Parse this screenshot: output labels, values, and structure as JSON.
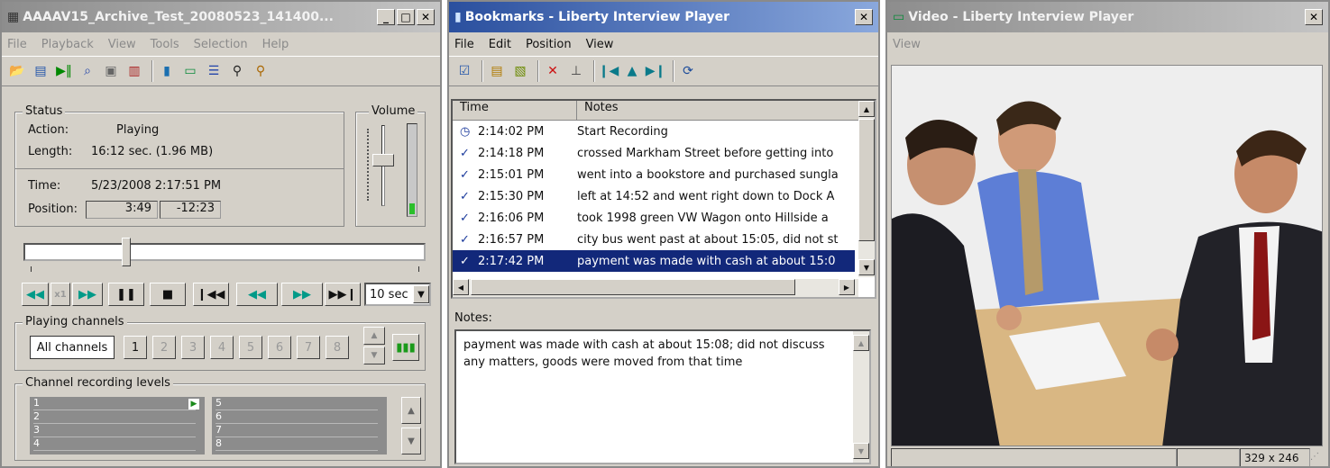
{
  "player": {
    "title": "AAAAV15_Archive_Test_20080523_141400...",
    "menu": [
      "File",
      "Playback",
      "View",
      "Tools",
      "Selection",
      "Help"
    ],
    "status_label": "Status",
    "action_label": "Action:",
    "action_value": "Playing",
    "length_label": "Length:",
    "length_value": "16:12 sec. (1.96 MB)",
    "time_label": "Time:",
    "time_value": "5/23/2008 2:17:51 PM",
    "position_label": "Position:",
    "position_elapsed": "3:49",
    "position_remaining": "-12:23",
    "volume_label": "Volume",
    "progress": 0.24,
    "skip_value": "10 sec",
    "playing_channels_label": "Playing channels",
    "all_channels_label": "All channels",
    "channels": [
      "1",
      "2",
      "3",
      "4",
      "5",
      "6",
      "7",
      "8"
    ],
    "levels_label": "Channel recording levels",
    "levels_left": [
      "1",
      "2",
      "3",
      "4"
    ],
    "levels_right": [
      "5",
      "6",
      "7",
      "8"
    ]
  },
  "bookmarks": {
    "title": "Bookmarks - Liberty Interview Player",
    "menu": [
      "File",
      "Edit",
      "Position",
      "View"
    ],
    "col_time": "Time",
    "col_notes": "Notes",
    "rows": [
      {
        "time": "2:14:02 PM",
        "note": "Start Recording",
        "icon": "clock-icon"
      },
      {
        "time": "2:14:18 PM",
        "note": "crossed Markham Street before getting into",
        "icon": "check-icon"
      },
      {
        "time": "2:15:01 PM",
        "note": "went into a bookstore and purchased sungla",
        "icon": "check-icon"
      },
      {
        "time": "2:15:30 PM",
        "note": "left at 14:52 and went right down to Dock A",
        "icon": "check-icon"
      },
      {
        "time": "2:16:06 PM",
        "note": "took 1998 green VW Wagon onto Hillside a",
        "icon": "check-icon"
      },
      {
        "time": "2:16:57 PM",
        "note": "city bus went past at about 15:05, did not st",
        "icon": "check-icon"
      },
      {
        "time": "2:17:42 PM",
        "note": "payment was made with cash at about 15:0",
        "icon": "check-icon"
      }
    ],
    "notes_label": "Notes:",
    "notes_text": "payment was made with cash at about 15:08; did not discuss any matters, goods were moved from that time"
  },
  "video": {
    "title": "Video - Liberty Interview Player",
    "menu": [
      "View"
    ],
    "size": "329 x 246"
  }
}
